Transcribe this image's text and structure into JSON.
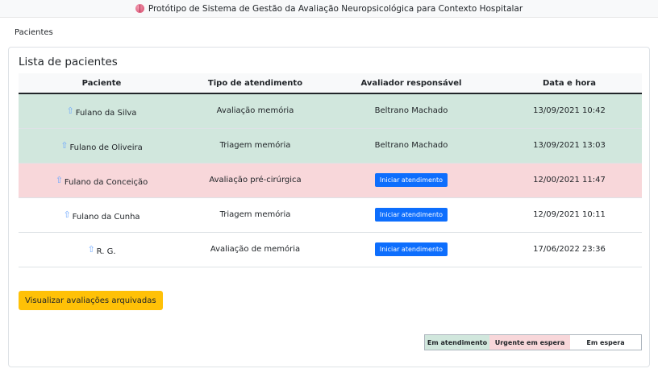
{
  "header": {
    "title": "Protótipo de Sistema de Gestão da Avaliação Neuropsicológica para Contexto Hospitalar",
    "icon": "brain-icon"
  },
  "breadcrumb": "Pacientes",
  "card": {
    "title": "Lista de pacientes"
  },
  "table": {
    "headers": [
      "Paciente",
      "Tipo de atendimento",
      "Avaliador responsável",
      "Data e hora"
    ],
    "rows": [
      {
        "status": "Em atendimento",
        "patient": "Fulano da Silva",
        "type": "Avaliação memória",
        "evaluator": "Beltrano Machado",
        "datetime": "13/09/2021 10:42"
      },
      {
        "status": "Em atendimento",
        "patient": "Fulano de Oliveira",
        "type": "Triagem memória",
        "evaluator": "Beltrano Machado",
        "datetime": "13/09/2021 13:03"
      },
      {
        "status": "Urgente em espera",
        "patient": "Fulano da Conceição",
        "type": "Avaliação pré-cirúrgica",
        "evaluator": "Iniciar atendimento",
        "datetime": "12/00/2021 11:47"
      },
      {
        "status": "Em espera",
        "patient": "Fulano da Cunha",
        "type": "Triagem memória",
        "evaluator": "Iniciar atendimento",
        "datetime": "12/09/2021 10:11"
      },
      {
        "status": "Em espera",
        "patient": "R. G.",
        "type": "Avaliação de memória",
        "evaluator": "Iniciar atendimento",
        "datetime": "17/06/2022 23:36"
      }
    ]
  },
  "actions": {
    "archived_label": "Visualizar avaliações arquivadas"
  },
  "legend": {
    "in_service": "Em atendimento",
    "urgent_waiting": "Urgente em espera",
    "waiting": "Em espera"
  },
  "colors": {
    "in_service": "#d1e7dd",
    "urgent_waiting": "#f8d7da",
    "waiting": "#ffffff",
    "primary_button": "#0d6efd",
    "archive_button": "#ffc107",
    "priority_arrow": "#6ea8fe"
  }
}
